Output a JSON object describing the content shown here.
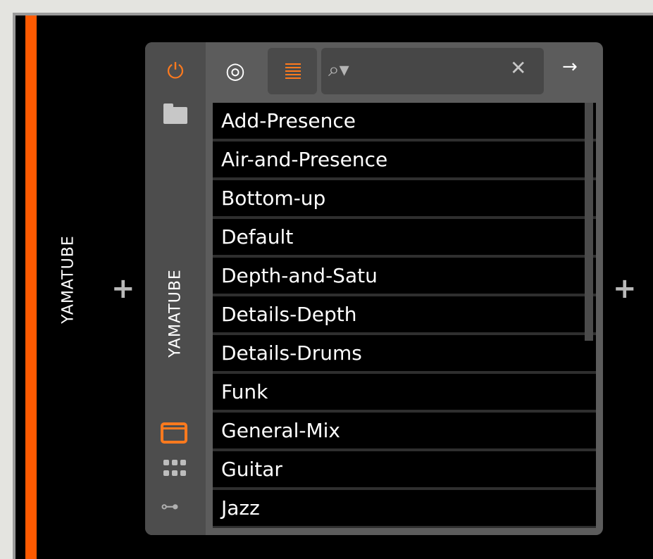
{
  "track": {
    "name": "YAMATUBE",
    "add_left": "+",
    "add_right": "+"
  },
  "device": {
    "name": "YAMATUBE",
    "power_icon": "power-icon",
    "folder_icon": "folder-icon",
    "window_icon": "window-icon",
    "grid_icon": "grid-icon",
    "key_icon": "key-icon"
  },
  "toolbar": {
    "preset_toggle_icon": "preset-icon",
    "list_icon": "list-icon",
    "search_icon": "search-icon",
    "search_value": "",
    "search_placeholder": "",
    "clear_icon": "clear-icon",
    "arrow_icon": "arrow-icon"
  },
  "presets": [
    "Add-Presence",
    "Air-and-Presence",
    "Bottom-up",
    "Default",
    "Depth-and-Satu",
    "Details-Depth",
    "Details-Drums",
    "Funk",
    "General-Mix",
    "Guitar",
    "Jazz"
  ],
  "colors": {
    "accent": "#ff5a00",
    "icon_orange": "#ff7a1e"
  }
}
